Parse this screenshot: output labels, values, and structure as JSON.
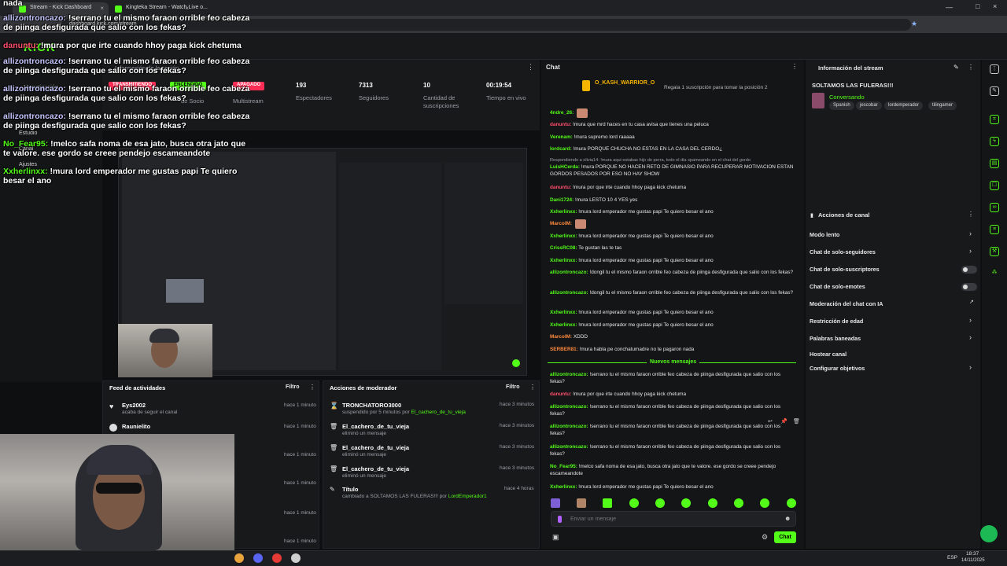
{
  "browser": {
    "tabs": [
      {
        "label": "Stream - Kick Dashboard"
      },
      {
        "label": "Kingteka Stream - Watch Live o..."
      }
    ],
    "url": "dashboard.kick.com/stream"
  },
  "overlay_chat": [
    {
      "user": "",
      "text": "nada"
    },
    {
      "user": "allizontroncazo:",
      "text": "!serrano tu el mismo faraon orrible feo cabeza de piinga desfigurada que salio con los fekas?"
    },
    {
      "user": "danuntu:",
      "text": "!mura por que irte cuando hhoy paga kick chetuma"
    },
    {
      "user": "allizontroncazo:",
      "text": "!serrano tu el mismo faraon orrible feo cabeza de piinga desfigurada que salio con los fekas?"
    },
    {
      "user": "allizontroncazo:",
      "text": "!serrano tu el mismo faraon orrible feo cabeza de piinga desfigurada que salio con los fekas?"
    },
    {
      "user": "allizontroncazo:",
      "text": "!serrano tu el mismo faraon orrible feo cabeza de piinga desfigurada que salio con los fekas?"
    },
    {
      "user": "No_Fear95:",
      "text": "!melco safa noma de esa jato, busca otra jato que te valore. ese gordo se creee pendejo escameandote"
    },
    {
      "user": "Xxherlinxx:",
      "text": "!mura lord emperador me gustas papi Te quiero besar el ano"
    }
  ],
  "stats": {
    "badges": [
      "TRANSMITIENDO",
      "ENCENDIDO",
      "APAGADO"
    ],
    "labels_left": [
      "Información de la sesión",
      "Monetización",
      "de Socio",
      "Multistream"
    ],
    "viewers": "193",
    "viewers_label": "Espectadores",
    "followers": "7313",
    "followers_label": "Seguidores",
    "subs": "10",
    "subs_label": "Cantidad de suscripciones",
    "live_time": "00:19:54",
    "live_time_label": "Tiempo en vivo"
  },
  "leftnav": [
    "Estudio",
    "Canal",
    "Ajustes",
    "Vista previa del stream"
  ],
  "activity": {
    "title": "Feed de actividades",
    "filter": "Filtro",
    "items": [
      {
        "name": "Eys2002",
        "sub": "acaba de seguir el canal",
        "time": "hace 1 minuto"
      },
      {
        "name": "Raunielito",
        "sub": "",
        "time": "hace 1 minuto"
      },
      {
        "name": "",
        "sub": "",
        "time": "hace 1 minuto"
      },
      {
        "name": "",
        "sub": "",
        "time": "hace 1 minuto"
      },
      {
        "name": "",
        "sub": "",
        "time": "hace 1 minuto"
      },
      {
        "name": "",
        "sub": "",
        "time": "hace 1 minuto"
      },
      {
        "name": "",
        "sub": "",
        "time": "hace 1 minuto"
      }
    ]
  },
  "modactions": {
    "title": "Acciones de moderador",
    "filter": "Filtro",
    "items": [
      {
        "name": "TRONCHATORO3000",
        "sub": "suspendido por 5 minutos por",
        "by": "El_cachero_de_tu_vieja",
        "time": "hace 3 minutos"
      },
      {
        "name": "El_cachero_de_tu_vieja",
        "sub": "eliminó un mensaje",
        "by": "",
        "time": "hace 3 minutos"
      },
      {
        "name": "El_cachero_de_tu_vieja",
        "sub": "eliminó un mensaje",
        "by": "",
        "time": "hace 3 minutos"
      },
      {
        "name": "El_cachero_de_tu_vieja",
        "sub": "eliminó un mensaje",
        "by": "",
        "time": "hace 3 minutos"
      },
      {
        "name": "Título",
        "sub": "cambiado a SOLTAMOS LAS FULERAS!!! por",
        "by": "LordEmperador1",
        "time": "hace 4 horas"
      }
    ]
  },
  "chat": {
    "title": "Chat",
    "top_user": "O_KASH_WARRIOR_O",
    "top_hint": "Regala 1 suscripción para tomar la posición 2",
    "messages": [
      {
        "user": "4ndre_26:",
        "text": "",
        "color": "#53fc18"
      },
      {
        "user": "danuntu:",
        "text": "!mura que mrd haces en tu casa avisa que tienes una peluca",
        "color": "#ff4f6d"
      },
      {
        "user": "Verenam:",
        "text": "!mura supremo lord raaaaa",
        "color": "#53fc18"
      },
      {
        "user": "lordcard:",
        "text": "!mura PORQUE CHUCHA NO ESTAS EN LA CASA DEL CERDO¿",
        "color": "#53fc18"
      },
      {
        "user": "",
        "text": "Respondiendo a olivia14: !mura aqui estabas hijo de perra, todo el dia spameando en el chat del gordo",
        "color": "#9aa0a6"
      },
      {
        "user": "LuisHCerda:",
        "text": "!mura PORQUE NO HACEN RETO DE GIMNASIO PARA RECUPERAR MOTIVACION ESTAN GORDOS PESADOS POR ESO NO HAY SHOW",
        "color": "#53fc18"
      },
      {
        "user": "danuntu:",
        "text": "!mura por que irte cuando hhoy paga kick chetuma",
        "color": "#ff4f6d"
      },
      {
        "user": "Dani1724:",
        "text": "!mura LESTO 10 4 YES yes",
        "color": "#53fc18"
      },
      {
        "user": "Xxherlinxx:",
        "text": "!mura lord emperador me gustas papi Te quiero besar el ano",
        "color": "#53fc18"
      },
      {
        "user": "MarcolM:",
        "text": "",
        "color": "#ff8a3d"
      },
      {
        "user": "Xxherlinxx:",
        "text": "!mura lord emperador me gustas papi Te quiero besar el ano",
        "color": "#53fc18"
      },
      {
        "user": "CrissRC08:",
        "text": "Te gustan las te tas",
        "color": "#53fc18"
      },
      {
        "user": "Xxherlinxx:",
        "text": "!mura lord emperador me gustas papi Te quiero besar el ano",
        "color": "#53fc18"
      },
      {
        "user": "allizontroncazo:",
        "text": "!dongil tu el mismo faraon orrible feo cabeza de piinga desfigurada que salio con los fekas?",
        "color": "#53fc18"
      },
      {
        "user": "allizontroncazo:",
        "text": "!dongil tu el mismo faraon orrible feo cabeza de piinga desfigurada que salio con los fekas?",
        "color": "#53fc18"
      },
      {
        "user": "Xxherlinxx:",
        "text": "!mura lord emperador me gustas papi Te quiero besar el ano",
        "color": "#53fc18"
      },
      {
        "user": "Xxherlinxx:",
        "text": "!mura lord emperador me gustas papi Te quiero besar el ano",
        "color": "#53fc18"
      },
      {
        "user": "MarcolM:",
        "text": "XDDD",
        "color": "#ff8a3d"
      },
      {
        "user": "SERBER81:",
        "text": "!mura habla pe conchatumadre no te pagaron nada",
        "color": "#ff8a3d"
      }
    ],
    "new_messages_label": "Nuevos mensajes",
    "new_messages": [
      {
        "user": "allizontroncazo:",
        "text": "!serrano tu el mismo faraon orrible feo cabeza de piinga desfigurada que salio con los fekas?",
        "color": "#53fc18"
      },
      {
        "user": "danuntu:",
        "text": "!mura por que irte cuando hhoy paga kick chetuma",
        "color": "#ff4f6d"
      },
      {
        "user": "allizontroncazo:",
        "text": "!serrano tu el mismo faraon orrible feo cabeza de piinga desfigurada que salio con los fekas?",
        "color": "#53fc18"
      },
      {
        "user": "allizontroncazo:",
        "text": "!serrano tu el mismo faraon orrible feo cabeza de piinga desfigurada que salio con los fekas?",
        "color": "#53fc18"
      },
      {
        "user": "allizontroncazo:",
        "text": "!serrano tu el mismo faraon orrible feo cabeza de piinga desfigurada que salio con los fekas?",
        "color": "#53fc18"
      },
      {
        "user": "No_Fear95:",
        "text": "!melco safa noma de esa jato, busca otra jato que te valore. ese gordo se creee pendejo escameandote",
        "color": "#53fc18"
      },
      {
        "user": "Xxherlinxx:",
        "text": "!mura lord emperador me gustas papi Te quiero besar el ano",
        "color": "#53fc18"
      }
    ],
    "input_placeholder": "Enviar un mensaje",
    "send_label": "Chat"
  },
  "streaminfo": {
    "title": "Información del stream",
    "stream_title": "SOLTAMOS LAS FULERAS!!!",
    "category": "Conversando",
    "tags": [
      "Spanish",
      "jescobar",
      "lordemperador",
      "tilingamer"
    ]
  },
  "channelactions": {
    "title": "Acciones de canal",
    "items": [
      {
        "label": "Modo lento",
        "control": "chevron"
      },
      {
        "label": "Chat de solo-seguidores",
        "control": "chevron"
      },
      {
        "label": "Chat de solo-suscriptores",
        "control": "toggle"
      },
      {
        "label": "Chat de solo-emotes",
        "control": "toggle"
      },
      {
        "label": "Moderación del chat con IA",
        "control": "link"
      },
      {
        "label": "Restricción de edad",
        "control": "chevron"
      },
      {
        "label": "Palabras baneadas",
        "control": "chevron"
      },
      {
        "label": "Hostear canal",
        "control": "none"
      },
      {
        "label": "Configurar objetivos",
        "control": "chevron"
      }
    ]
  },
  "taskbar": {
    "lang": "ESP",
    "time": "18:37",
    "date": "14/11/2025"
  },
  "colors": {
    "accent": "#53fc18",
    "bg": "#0e0f11",
    "panel": "#18191b"
  }
}
